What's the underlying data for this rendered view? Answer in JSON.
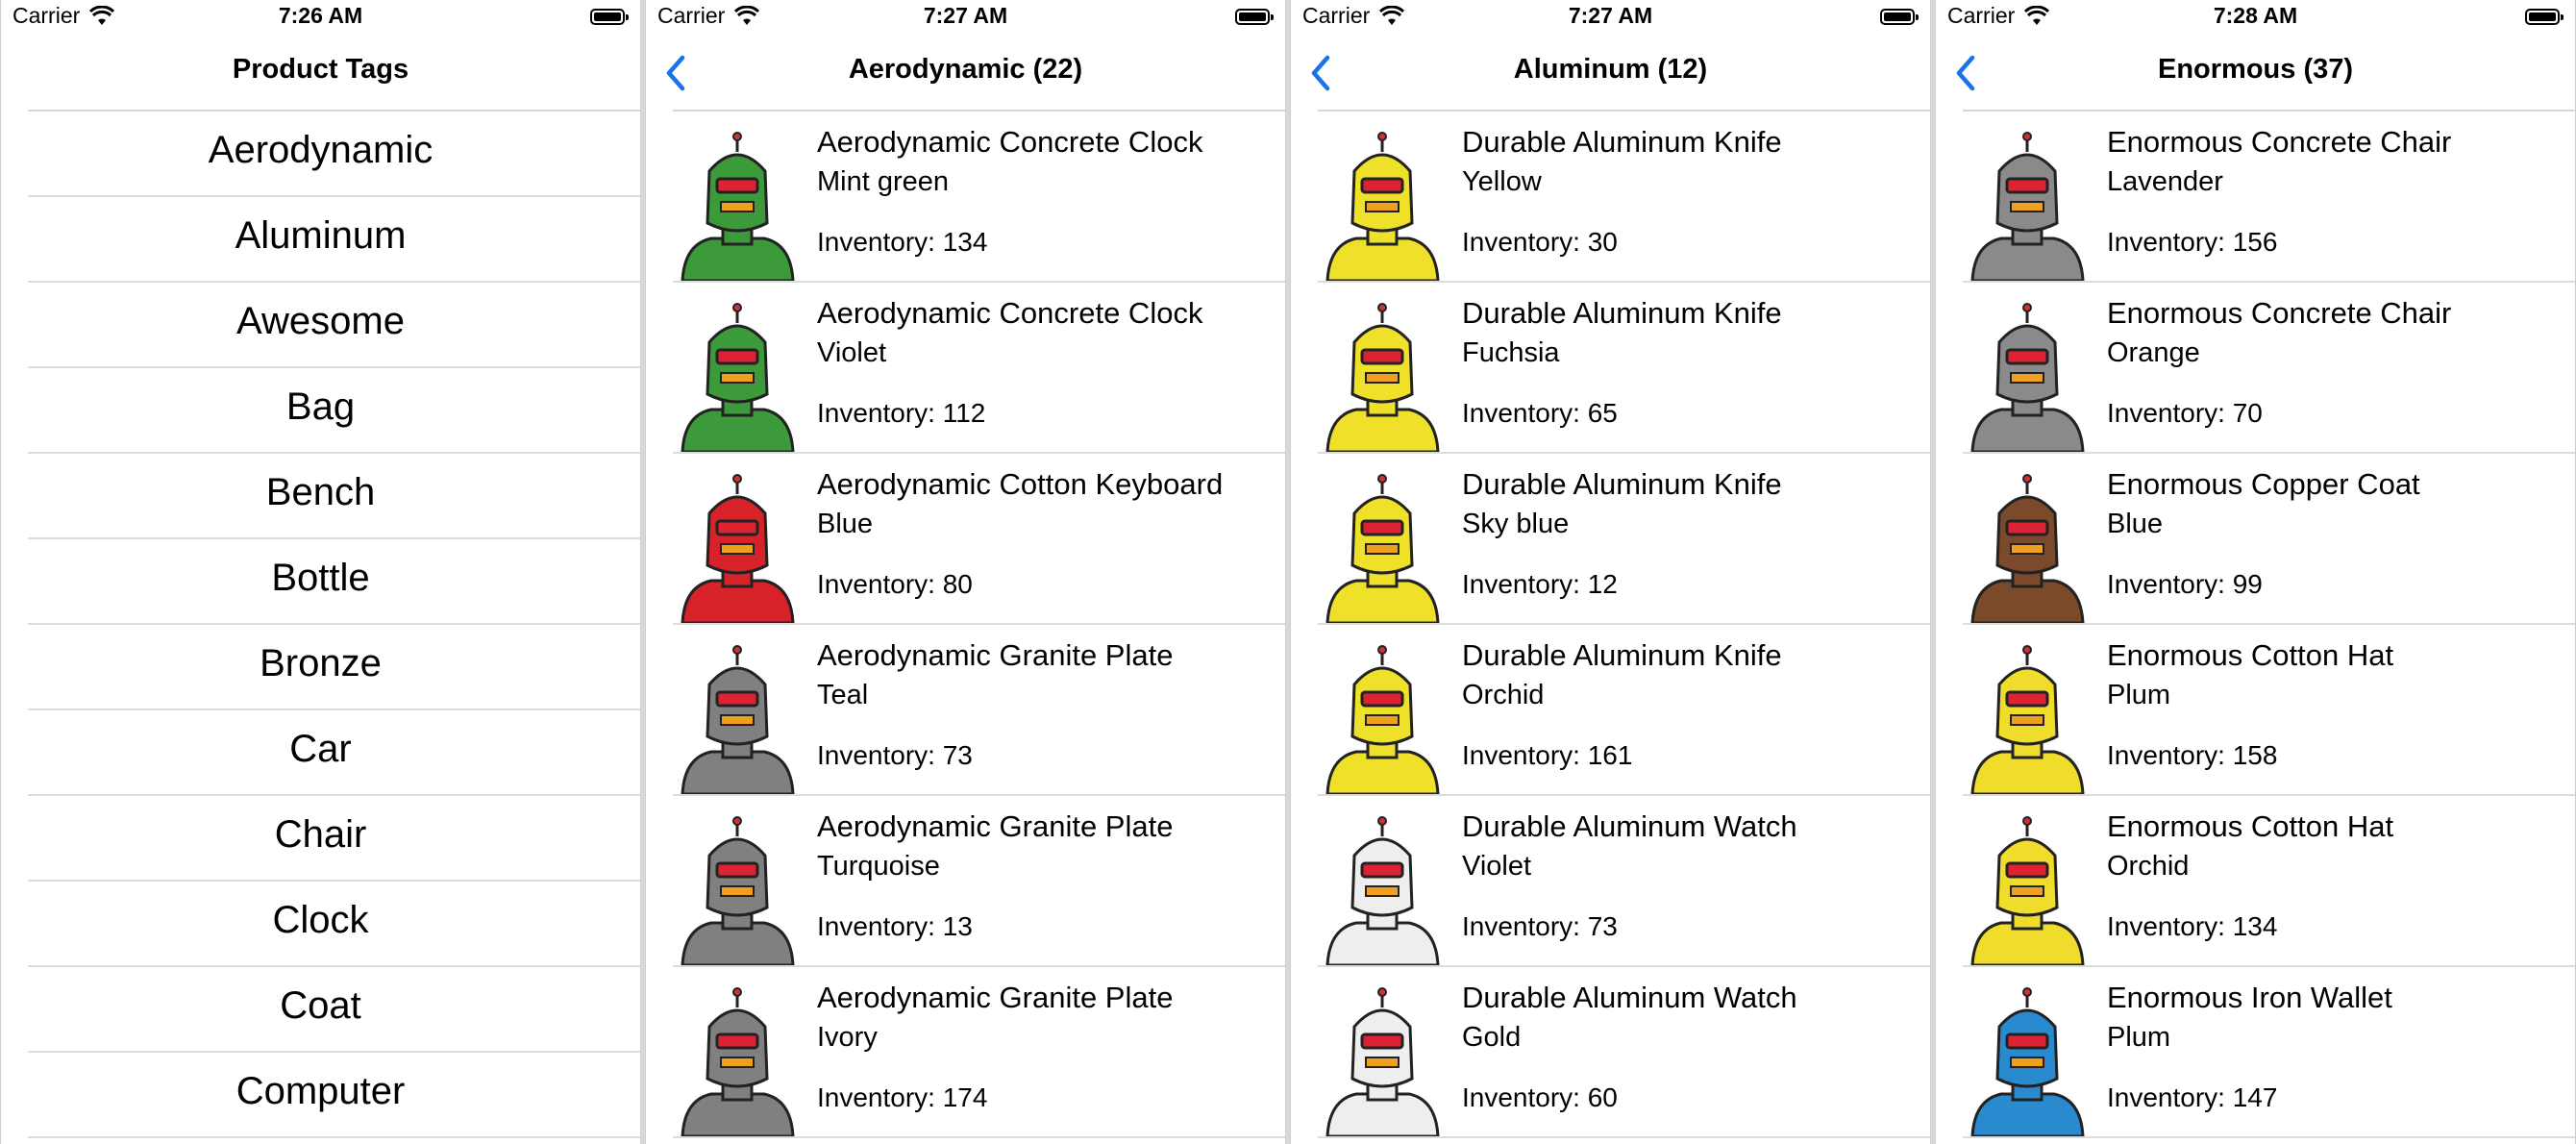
{
  "screens": [
    {
      "status": {
        "carrier": "Carrier",
        "time": "7:26 AM"
      },
      "nav": {
        "title": "Product Tags"
      },
      "tags": [
        "Aerodynamic",
        "Aluminum",
        "Awesome",
        "Bag",
        "Bench",
        "Bottle",
        "Bronze",
        "Car",
        "Chair",
        "Clock",
        "Coat",
        "Computer"
      ]
    },
    {
      "status": {
        "carrier": "Carrier",
        "time": "7:27 AM"
      },
      "nav": {
        "title": "Aerodynamic (22)"
      },
      "products": [
        {
          "name": "Aerodynamic Concrete Clock",
          "color": "Mint green",
          "inventory": "Inventory: 134",
          "robot_color": "#3c9a3a"
        },
        {
          "name": "Aerodynamic Concrete Clock",
          "color": "Violet",
          "inventory": "Inventory: 112",
          "robot_color": "#3c9a3a"
        },
        {
          "name": "Aerodynamic Cotton Keyboard",
          "color": "Blue",
          "inventory": "Inventory: 80",
          "robot_color": "#d8222a"
        },
        {
          "name": "Aerodynamic Granite Plate",
          "color": "Teal",
          "inventory": "Inventory: 73",
          "robot_color": "#808080"
        },
        {
          "name": "Aerodynamic Granite Plate",
          "color": "Turquoise",
          "inventory": "Inventory: 13",
          "robot_color": "#808080"
        },
        {
          "name": "Aerodynamic Granite Plate",
          "color": "Ivory",
          "inventory": "Inventory: 174",
          "robot_color": "#808080"
        }
      ]
    },
    {
      "status": {
        "carrier": "Carrier",
        "time": "7:27 AM"
      },
      "nav": {
        "title": "Aluminum (12)"
      },
      "products": [
        {
          "name": "Durable Aluminum Knife",
          "color": "Yellow",
          "inventory": "Inventory: 30",
          "robot_color": "#efe02a"
        },
        {
          "name": "Durable Aluminum Knife",
          "color": "Fuchsia",
          "inventory": "Inventory: 65",
          "robot_color": "#efe02a"
        },
        {
          "name": "Durable Aluminum Knife",
          "color": "Sky blue",
          "inventory": "Inventory: 12",
          "robot_color": "#efe02a"
        },
        {
          "name": "Durable Aluminum Knife",
          "color": "Orchid",
          "inventory": "Inventory: 161",
          "robot_color": "#efe02a"
        },
        {
          "name": "Durable Aluminum Watch",
          "color": "Violet",
          "inventory": "Inventory: 73",
          "robot_color": "#eeeeee"
        },
        {
          "name": "Durable Aluminum Watch",
          "color": "Gold",
          "inventory": "Inventory: 60",
          "robot_color": "#eeeeee"
        }
      ]
    },
    {
      "status": {
        "carrier": "Carrier",
        "time": "7:28 AM"
      },
      "nav": {
        "title": "Enormous (37)"
      },
      "products": [
        {
          "name": "Enormous Concrete Chair",
          "color": "Lavender",
          "inventory": "Inventory: 156",
          "robot_color": "#8a8a8a"
        },
        {
          "name": "Enormous Concrete Chair",
          "color": "Orange",
          "inventory": "Inventory: 70",
          "robot_color": "#8a8a8a"
        },
        {
          "name": "Enormous Copper Coat",
          "color": "Blue",
          "inventory": "Inventory: 99",
          "robot_color": "#7a4a2a"
        },
        {
          "name": "Enormous Cotton Hat",
          "color": "Plum",
          "inventory": "Inventory: 158",
          "robot_color": "#f0dc2a"
        },
        {
          "name": "Enormous Cotton Hat",
          "color": "Orchid",
          "inventory": "Inventory: 134",
          "robot_color": "#f0dc2a"
        },
        {
          "name": "Enormous Iron Wallet",
          "color": "Plum",
          "inventory": "Inventory: 147",
          "robot_color": "#2a8ad0"
        }
      ]
    }
  ],
  "accent_color": "#1a73e8"
}
